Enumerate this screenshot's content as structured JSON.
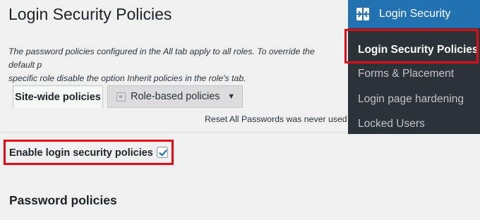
{
  "page": {
    "title": "Login Security Policies",
    "description": "The password policies configured in the All tab apply to all roles. To override the default policies and configure policies for a specific role disable the option Inherit policies in the role's tab.",
    "description_line1": "The password policies configured in the All tab apply to all roles. To override the default p",
    "description_line2": "specific role disable the option Inherit policies in the role's tab."
  },
  "tabs": {
    "site_wide": "Site-wide policies",
    "role_based": "Role-based policies"
  },
  "reset_note": "Reset All Passwords was never used",
  "enable": {
    "label": "Enable login security policies",
    "checked": true
  },
  "section": {
    "password_policies": "Password policies"
  },
  "menu": {
    "title": "Login Security",
    "icon": "login-security-plugin-icon",
    "items": [
      {
        "label": "Login Security Policies",
        "active": true
      },
      {
        "label": "Forms & Placement",
        "active": false
      },
      {
        "label": "Login page hardening",
        "active": false
      },
      {
        "label": "Locked Users",
        "active": false
      }
    ]
  },
  "colors": {
    "header_blue": "#2271b1",
    "menu_dark": "#2c3338",
    "highlight_red": "#e30b17",
    "checkbox_blue": "#2271b1"
  }
}
